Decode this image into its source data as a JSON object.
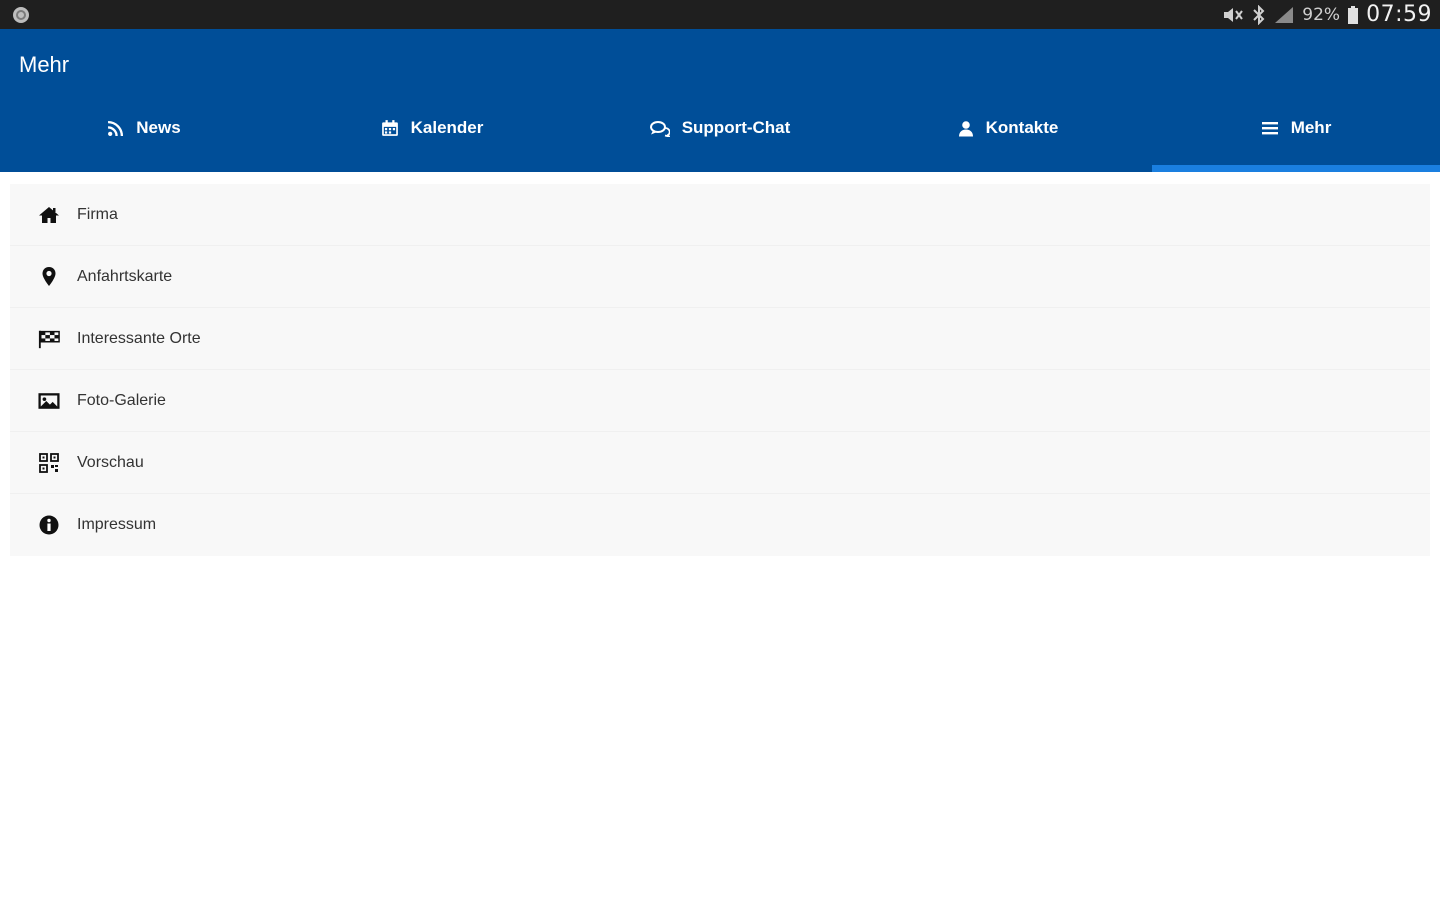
{
  "status_bar": {
    "battery_percent": "92%",
    "time": "07:59",
    "icons": [
      "app-notification-icon",
      "mute-icon",
      "bluetooth-icon",
      "signal-icon",
      "battery-icon"
    ]
  },
  "app_bar": {
    "title": "Mehr",
    "background_color": "#004e98",
    "accent_color": "#1a7fe0"
  },
  "tabs": [
    {
      "label": "News",
      "icon": "rss-icon"
    },
    {
      "label": "Kalender",
      "icon": "calendar-icon"
    },
    {
      "label": "Support-Chat",
      "icon": "chat-icon"
    },
    {
      "label": "Kontakte",
      "icon": "user-icon"
    },
    {
      "label": "Mehr",
      "icon": "menu-icon",
      "active": true
    }
  ],
  "menu": {
    "items": [
      {
        "label": "Firma",
        "icon": "home-icon"
      },
      {
        "label": "Anfahrtskarte",
        "icon": "map-marker-icon"
      },
      {
        "label": "Interessante Orte",
        "icon": "flag-checkered-icon"
      },
      {
        "label": "Foto-Galerie",
        "icon": "photo-icon"
      },
      {
        "label": "Vorschau",
        "icon": "qrcode-icon"
      },
      {
        "label": "Impressum",
        "icon": "info-icon"
      }
    ]
  }
}
